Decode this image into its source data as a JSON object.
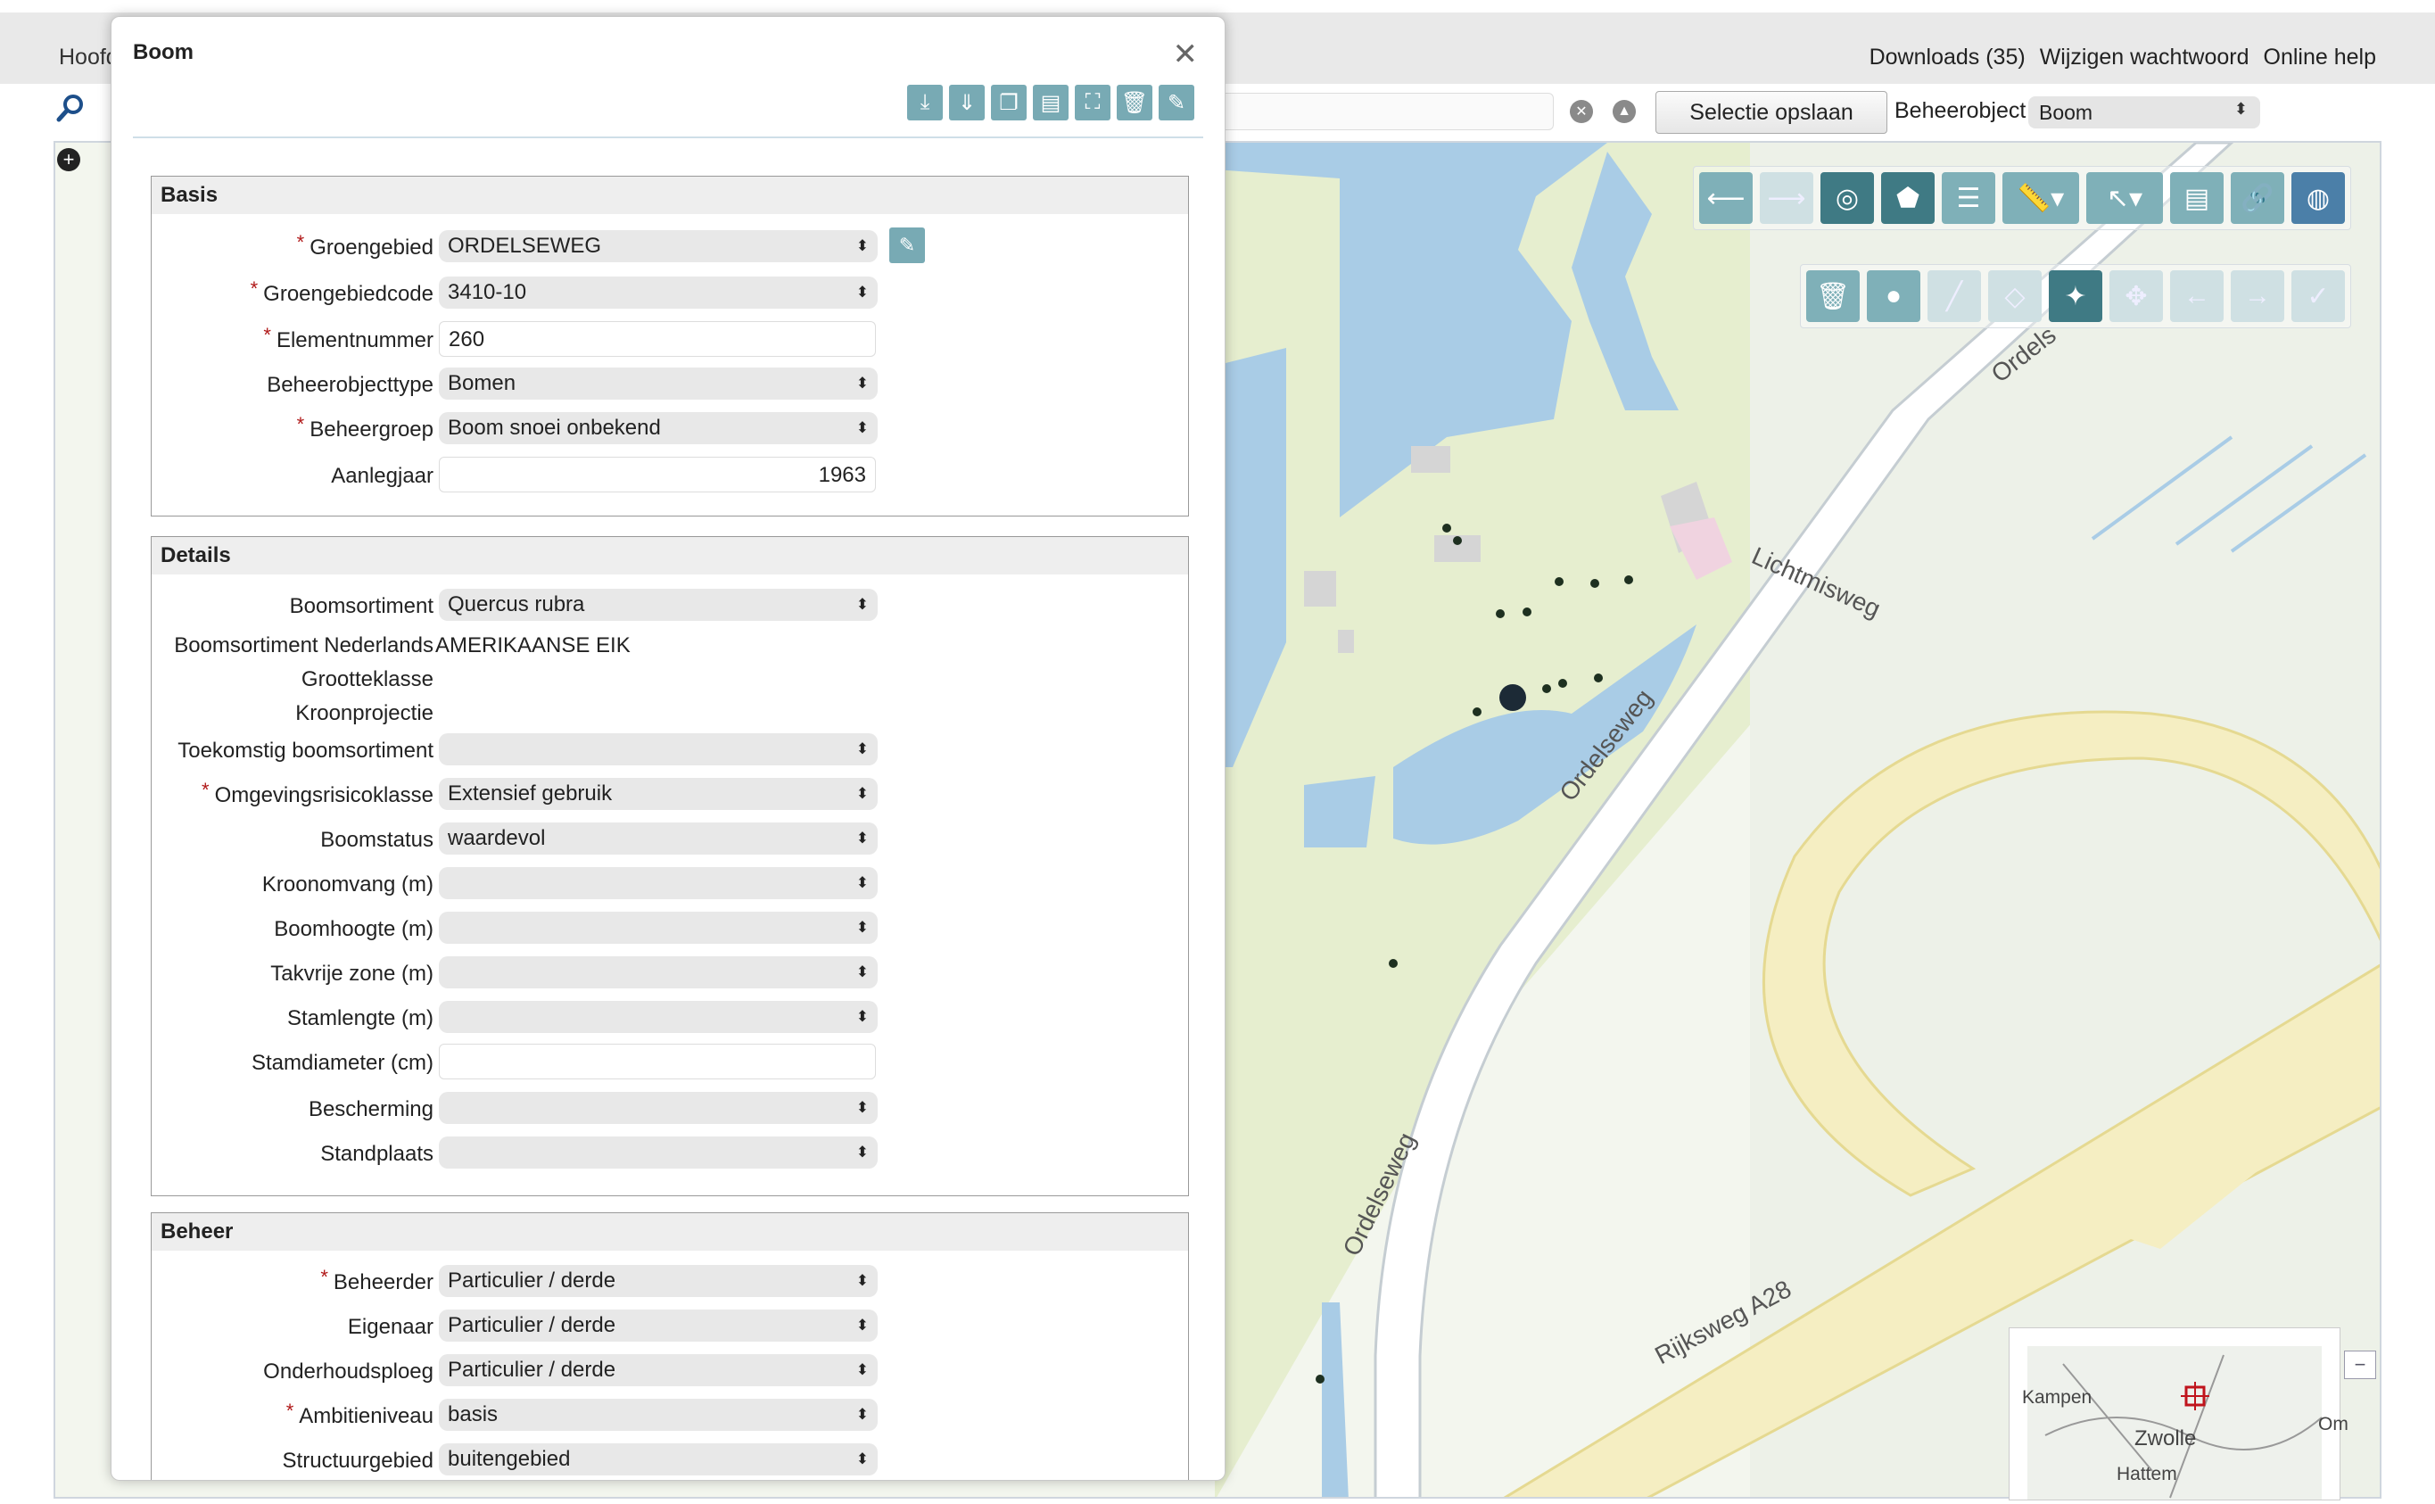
{
  "header": {
    "home_partial": "Hoofd",
    "links": [
      "Downloads (35)",
      "Wijzigen wachtwoord",
      "Online help"
    ]
  },
  "toolbar": {
    "save_selection": "Selectie opslaan",
    "beheerobject_label": "Beheerobject",
    "beheerobject_value": "Boom"
  },
  "map": {
    "roads": [
      "Lichtmisweg",
      "Ordelseweg",
      "Ordelseweg",
      "Ordelseweg",
      "Rijksweg A28",
      "Ordels"
    ],
    "overview_labels": [
      "Kampen",
      "Zwolle",
      "Hattem",
      "Om"
    ]
  },
  "dialog": {
    "title": "Boom",
    "sections": {
      "basis": {
        "title": "Basis",
        "fields": [
          {
            "label": "Groengebied",
            "value": "ORDELSEWEG",
            "required": true
          },
          {
            "label": "Groengebiedcode",
            "value": "3410-10",
            "required": true
          },
          {
            "label": "Elementnummer",
            "value": "260",
            "required": true
          },
          {
            "label": "Beheerobjecttype",
            "value": "Bomen",
            "required": false
          },
          {
            "label": "Beheergroep",
            "value": "Boom snoei onbekend",
            "required": true
          },
          {
            "label": "Aanlegjaar",
            "value": "1963",
            "required": false
          }
        ]
      },
      "details": {
        "title": "Details",
        "fields": [
          {
            "label": "Boomsortiment",
            "value": "Quercus rubra"
          },
          {
            "label": "Boomsortiment Nederlands",
            "value": "AMERIKAANSE EIK"
          },
          {
            "label": "Grootteklasse",
            "value": ""
          },
          {
            "label": "Kroonprojectie",
            "value": ""
          },
          {
            "label": "Toekomstig boomsortiment",
            "value": ""
          },
          {
            "label": "Omgevingsrisicoklasse",
            "value": "Extensief gebruik",
            "required": true
          },
          {
            "label": "Boomstatus",
            "value": "waardevol"
          },
          {
            "label": "Kroonomvang (m)",
            "value": ""
          },
          {
            "label": "Boomhoogte (m)",
            "value": ""
          },
          {
            "label": "Takvrije zone (m)",
            "value": ""
          },
          {
            "label": "Stamlengte (m)",
            "value": ""
          },
          {
            "label": "Stamdiameter (cm)",
            "value": ""
          },
          {
            "label": "Bescherming",
            "value": ""
          },
          {
            "label": "Standplaats",
            "value": ""
          }
        ]
      },
      "beheer": {
        "title": "Beheer",
        "fields": [
          {
            "label": "Beheerder",
            "value": "Particulier / derde",
            "required": true
          },
          {
            "label": "Eigenaar",
            "value": "Particulier / derde"
          },
          {
            "label": "Onderhoudsploeg",
            "value": "Particulier / derde"
          },
          {
            "label": "Ambitieniveau",
            "value": "basis",
            "required": true
          },
          {
            "label": "Structuurgebied",
            "value": "buitengebied"
          }
        ]
      }
    },
    "required_marker": "*"
  },
  "colors": {
    "accent": "#78aab4",
    "water": "#a9cce6",
    "road": "#f5eec2",
    "land": "#f4f6ea"
  }
}
